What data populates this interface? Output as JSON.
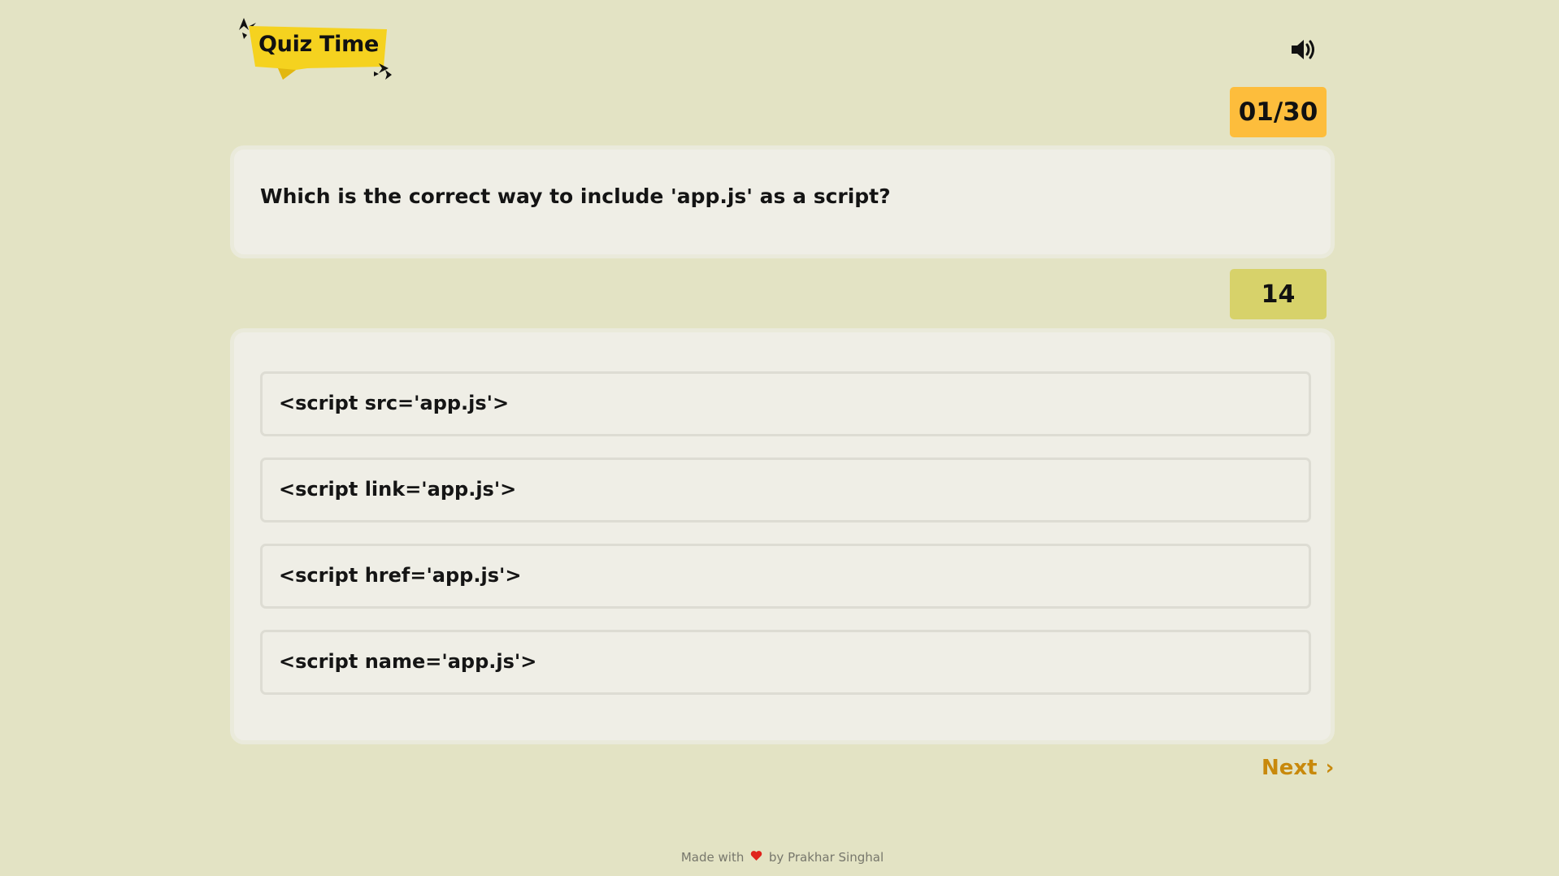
{
  "app": {
    "logo_text": "Quiz Time",
    "brand_yellow": "#f5d21f",
    "background": "#e3e3c4"
  },
  "header": {
    "sound_icon": "volume-up-icon"
  },
  "quiz": {
    "progress": "01/30",
    "question": "Which is the correct way to include 'app.js' as a script?",
    "timer": "14",
    "options": [
      {
        "label": "<script src='app.js'>"
      },
      {
        "label": "<script link='app.js'>"
      },
      {
        "label": "<script href='app.js'>"
      },
      {
        "label": "<script name='app.js'>"
      }
    ],
    "next_label": "Next",
    "next_icon": "chevron-right-icon"
  },
  "footer": {
    "prefix": "Made with",
    "heart_icon": "heart-icon",
    "suffix": "by Prakhar Singhal"
  },
  "colors": {
    "counter_bg": "#fdbd3c",
    "timer_bg": "#d7d26a",
    "next_text": "#c8890c",
    "heart": "#e0241c"
  }
}
